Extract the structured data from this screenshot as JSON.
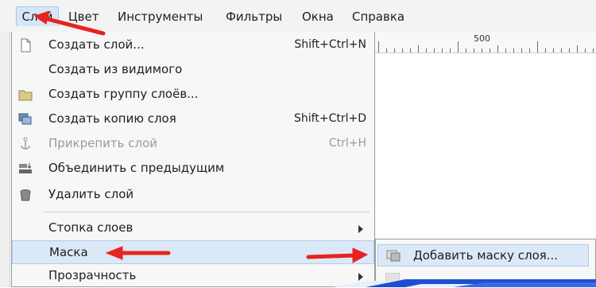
{
  "menubar": {
    "items": [
      {
        "label": "Слой",
        "active": true
      },
      {
        "label": "Цвет"
      },
      {
        "label": "Инструменты"
      },
      {
        "label": "Фильтры"
      },
      {
        "label": "Окна"
      },
      {
        "label": "Справка"
      }
    ]
  },
  "ruler": {
    "label": "500"
  },
  "layer_menu": {
    "items": [
      {
        "label": "Создать слой...",
        "shortcut": "Shift+Ctrl+N",
        "icon": "new-layer-icon"
      },
      {
        "label": "Создать из видимого",
        "icon": ""
      },
      {
        "label": "Создать группу слоёв...",
        "icon": "folder-icon"
      },
      {
        "label": "Создать копию слоя",
        "shortcut": "Shift+Ctrl+D",
        "icon": "duplicate-layer-icon"
      },
      {
        "label": "Прикрепить слой",
        "shortcut": "Ctrl+H",
        "icon": "anchor-icon",
        "disabled": true
      },
      {
        "label": "Объединить с предыдущим",
        "icon": "merge-down-icon"
      },
      {
        "label": "Удалить слой",
        "icon": "trash-icon"
      },
      {
        "label": "Стопка слоев",
        "submenu": true
      },
      {
        "label": "Маска",
        "submenu": true,
        "highlighted": true
      },
      {
        "label": "Прозрачность",
        "submenu": true
      }
    ]
  },
  "mask_submenu": {
    "items": [
      {
        "label": "Добавить маску слоя...",
        "icon": "layer-mask-icon",
        "highlighted": true
      }
    ]
  },
  "colors": {
    "annotation_arrow": "#e8231f",
    "highlight": "#dbe8f7",
    "corner_decoration": "#1f4fd1"
  }
}
